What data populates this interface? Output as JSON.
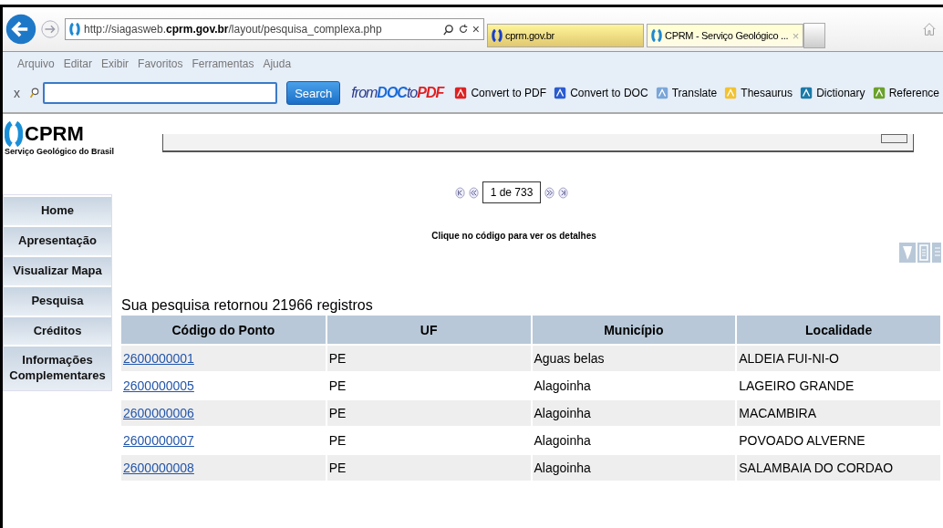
{
  "browser": {
    "address": {
      "prefix": "http://siagasweb.",
      "domain": "cprm.gov.br",
      "path": "/layout/pesquisa_complexa.php"
    },
    "tabs": [
      {
        "title": "cprm.gov.br",
        "selected": false
      },
      {
        "title": "CPRM - Serviço Geológico ...",
        "selected": true
      }
    ],
    "close_glyph": "×",
    "menu": [
      "Arquivo",
      "Editar",
      "Exibir",
      "Favoritos",
      "Ferramentas",
      "Ajuda"
    ],
    "toolbar": {
      "close_glyph": "x",
      "search_button": "Search",
      "brand": {
        "part1": "from",
        "part2": "DOC",
        "part3": "to",
        "part4": "PDF"
      },
      "items": [
        {
          "label": "Convert to PDF",
          "kind": "pdf"
        },
        {
          "label": "Convert to DOC",
          "kind": "doc"
        },
        {
          "label": "Translate",
          "kind": "translate"
        },
        {
          "label": "Thesaurus",
          "kind": "thesaurus"
        },
        {
          "label": "Dictionary",
          "kind": "dictionary"
        },
        {
          "label": "Reference",
          "kind": "reference"
        }
      ]
    }
  },
  "logo": {
    "name": "CPRM",
    "subtitle": "Serviço Geológico do Brasil"
  },
  "sidebar": {
    "items": [
      "Home",
      "Apresentação",
      "Visualizar Mapa",
      "Pesquisa",
      "Créditos",
      "Informações Complementares"
    ]
  },
  "pagination": {
    "page": "1 de 733"
  },
  "hint": "Clique no código para ver os detalhes",
  "results": {
    "summary": "Sua pesquisa retornou 21966 registros",
    "columns": [
      "Código do Ponto",
      "UF",
      "Município",
      "Localidade"
    ],
    "rows": [
      [
        "2600000001",
        "PE",
        "Aguas belas",
        "ALDEIA FUI-NI-O"
      ],
      [
        "2600000005",
        "PE",
        "Alagoinha",
        "LAGEIRO GRANDE"
      ],
      [
        "2600000006",
        "PE",
        "Alagoinha",
        "MACAMBIRA"
      ],
      [
        "2600000007",
        "PE",
        "Alagoinha",
        "POVOADO ALVERNE"
      ],
      [
        "2600000008",
        "PE",
        "Alagoinha",
        "SALAMBAIA DO CORDAO"
      ]
    ]
  }
}
